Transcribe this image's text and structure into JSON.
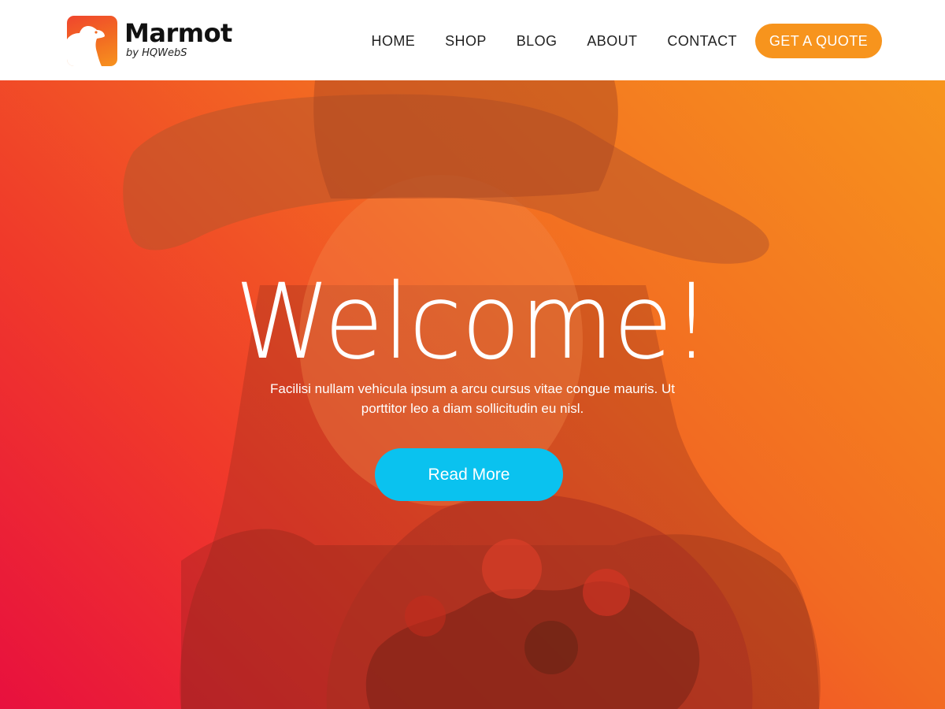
{
  "brand": {
    "name": "Marmot",
    "tagline": "by HQWebS"
  },
  "nav": {
    "items": [
      {
        "label": "HOME"
      },
      {
        "label": "SHOP"
      },
      {
        "label": "BLOG"
      },
      {
        "label": "ABOUT"
      },
      {
        "label": "CONTACT"
      }
    ],
    "cta_label": "GET A QUOTE"
  },
  "hero": {
    "title": "Welcome!",
    "description": "Facilisi nullam vehicula ipsum a arcu cursus vitae congue mauris. Ut porttitor leo a diam sollicitudin eu nisl.",
    "button_label": "Read More"
  },
  "colors": {
    "accent_orange": "#f7941d",
    "button_cyan": "#0ac2ef",
    "gradient_red": "#e8103e",
    "gradient_orange": "#f7941d"
  },
  "icons": [
    "marmot-logo-icon"
  ]
}
